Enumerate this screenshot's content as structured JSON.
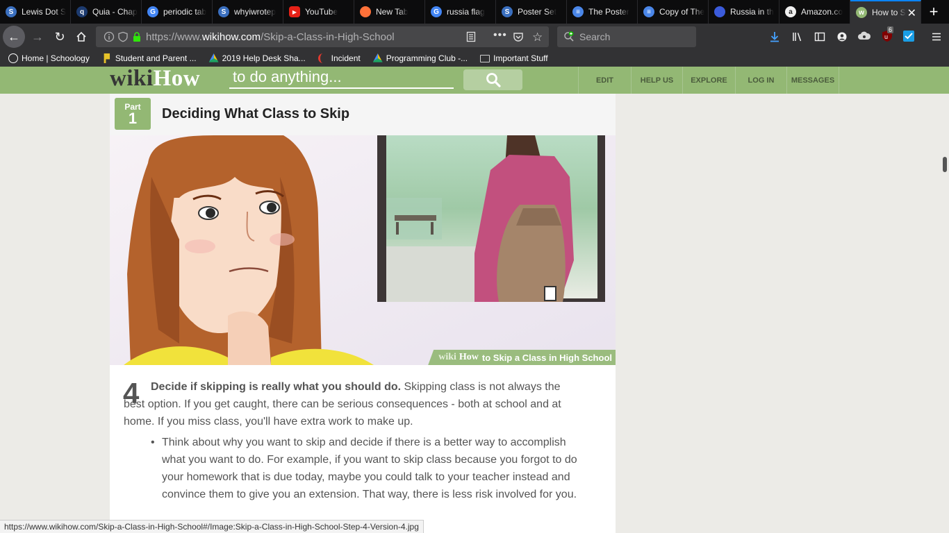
{
  "tabs": [
    {
      "title": "Lewis Dot S",
      "icon": "schoology-icon",
      "color": "#3a6fbf"
    },
    {
      "title": "Quia - Chap",
      "icon": "quia-icon",
      "color": "#1d3b6f"
    },
    {
      "title": "periodic tab",
      "icon": "google-icon",
      "color": "#4285f4"
    },
    {
      "title": "whyiwrotep",
      "icon": "schoology-icon",
      "color": "#3a6fbf"
    },
    {
      "title": "YouTube",
      "icon": "youtube-icon",
      "color": "#e62117"
    },
    {
      "title": "New Tab",
      "icon": "firefox-icon",
      "color": "#ff7139"
    },
    {
      "title": "russia flag",
      "icon": "google-icon",
      "color": "#4285f4"
    },
    {
      "title": "Poster Set",
      "icon": "schoology-icon",
      "color": "#3a6fbf"
    },
    {
      "title": "The Poster",
      "icon": "docs-icon",
      "color": "#4a86e8"
    },
    {
      "title": "Copy of The",
      "icon": "docs-icon",
      "color": "#4a86e8"
    },
    {
      "title": "Russia in th",
      "icon": "globe-icon",
      "color": "#3b5bdb"
    },
    {
      "title": "Amazon.co",
      "icon": "amazon-icon",
      "color": "#f0f0f0"
    },
    {
      "title": "How to S",
      "icon": "wikihow-icon",
      "color": "#93b874",
      "active": true
    }
  ],
  "nav": {
    "url_prefix": "https://www.",
    "url_domain": "wikihow.com",
    "url_path": "/Skip-a-Class-in-High-School",
    "search_placeholder": "Search",
    "ublock_badge": "6"
  },
  "bookmarks": [
    {
      "label": "Home | Schoology",
      "icon": "schoology-icon"
    },
    {
      "label": "Student and Parent ...",
      "icon": "p-logo-icon"
    },
    {
      "label": "2019 Help Desk Sha...",
      "icon": "drive-icon"
    },
    {
      "label": "Incident",
      "icon": "incident-icon"
    },
    {
      "label": "Programming Club -...",
      "icon": "drive-icon"
    },
    {
      "label": "Important Stuff",
      "icon": "folder-icon"
    }
  ],
  "wikihow": {
    "logo_wiki": "wiki",
    "logo_how": "How",
    "search_placeholder": "to do anything...",
    "menu": [
      "EDIT",
      "HELP US",
      "EXPLORE",
      "LOG IN",
      "MESSAGES"
    ]
  },
  "article": {
    "part_word": "Part",
    "part_number": "1",
    "part_title": "Deciding What Class to Skip",
    "caption_wiki": "wiki",
    "caption_how": "How",
    "caption_text": "to Skip a Class in High School",
    "step_number": "4",
    "step_bold": "Decide if skipping is really what you should do.",
    "step_text": " Skipping class is not always the best option. If you get caught, there can be serious consequences - both at school and at home. If you miss class, you'll have extra work to make up.",
    "bullet": "Think about why you want to skip and decide if there is a better way to accomplish what you want to do. For example, if you want to skip class because you forgot to do your homework that is due today, maybe you could talk to your teacher instead and convince them to give you an extension. That way, there is less risk involved for you."
  },
  "status_url": "https://www.wikihow.com/Skip-a-Class-in-High-School#/Image:Skip-a-Class-in-High-School-Step-4-Version-4.jpg"
}
